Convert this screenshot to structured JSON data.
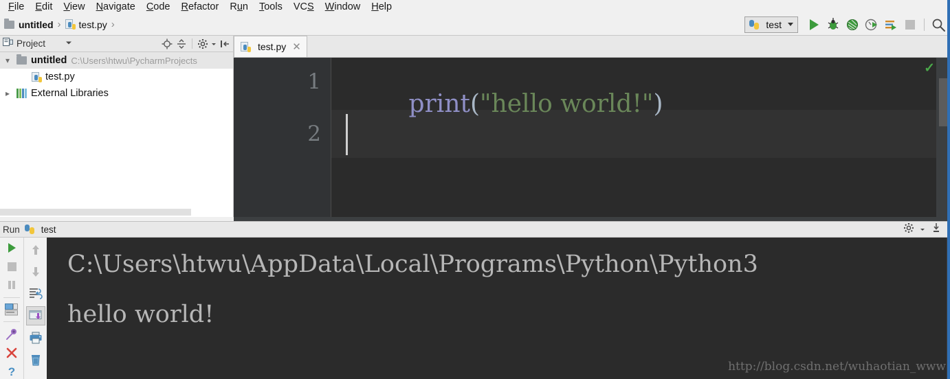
{
  "menu": {
    "items": [
      {
        "label": "File",
        "accel": "F"
      },
      {
        "label": "Edit",
        "accel": "E"
      },
      {
        "label": "View",
        "accel": "V"
      },
      {
        "label": "Navigate",
        "accel": "N"
      },
      {
        "label": "Code",
        "accel": "C"
      },
      {
        "label": "Refactor",
        "accel": "R"
      },
      {
        "label": "Run",
        "accel": "u"
      },
      {
        "label": "Tools",
        "accel": "T"
      },
      {
        "label": "VCS",
        "accel": "S"
      },
      {
        "label": "Window",
        "accel": "W"
      },
      {
        "label": "Help",
        "accel": "H"
      }
    ]
  },
  "breadcrumb": {
    "project": "untitled",
    "file": "test.py",
    "separator": "›"
  },
  "toolbar": {
    "run_config_name": "test",
    "buttons": [
      {
        "name": "run-button",
        "title": "Run"
      },
      {
        "name": "debug-button",
        "title": "Debug"
      },
      {
        "name": "coverage-button",
        "title": "Run with Coverage"
      },
      {
        "name": "profile-button",
        "title": "Profile"
      },
      {
        "name": "concurrency-button",
        "title": "Concurrency Diagram"
      },
      {
        "name": "stop-button",
        "title": "Stop"
      },
      {
        "name": "search-everywhere-button",
        "title": "Search Everywhere"
      }
    ]
  },
  "project_panel": {
    "title": "Project",
    "tree": [
      {
        "label": "untitled",
        "path": "C:\\Users\\htwu\\PycharmProjects",
        "expanded": true,
        "selected": true
      },
      {
        "label": "test.py",
        "expanded": false,
        "selected": false
      },
      {
        "label": "External Libraries",
        "expanded": false,
        "selected": false
      }
    ],
    "toolbar_icons": [
      "locate-icon",
      "collapse-all-icon",
      "settings-gear-icon",
      "hide-panel-icon"
    ]
  },
  "editor": {
    "tab_label": "test.py",
    "lines": [
      {
        "number": "1",
        "func": "print",
        "open_paren": "(",
        "string": "\"hello world!\"",
        "close_paren": ")"
      },
      {
        "number": "2",
        "func": "",
        "open_paren": "",
        "string": "",
        "close_paren": ""
      }
    ],
    "inspection_ok": "✓",
    "colors": {
      "background": "#2b2b2b",
      "gutter": "#313335",
      "current_line": "#323232",
      "function": "#8f8fc6",
      "string": "#6a8759",
      "punctuation": "#a9b7c6",
      "line_number": "#787d81"
    }
  },
  "run_panel": {
    "label": "Run",
    "tab_name": "test",
    "console_lines": [
      "C:\\Users\\htwu\\AppData\\Local\\Programs\\Python\\Python3",
      "hello world!"
    ],
    "watermark": "http://blog.csdn.net/wuhaotian_www",
    "left_icons": [
      "rerun-icon",
      "stop-icon",
      "pause-icon",
      "layout-icon",
      "pin-icon",
      "close-icon",
      "help-icon"
    ],
    "right_icons": [
      "up-arrow-icon",
      "down-arrow-icon",
      "soft-wrap-icon",
      "scroll-to-end-icon",
      "print-icon",
      "trash-icon"
    ],
    "header_icons": [
      "settings-gear-icon",
      "hide-panel-icon"
    ]
  }
}
